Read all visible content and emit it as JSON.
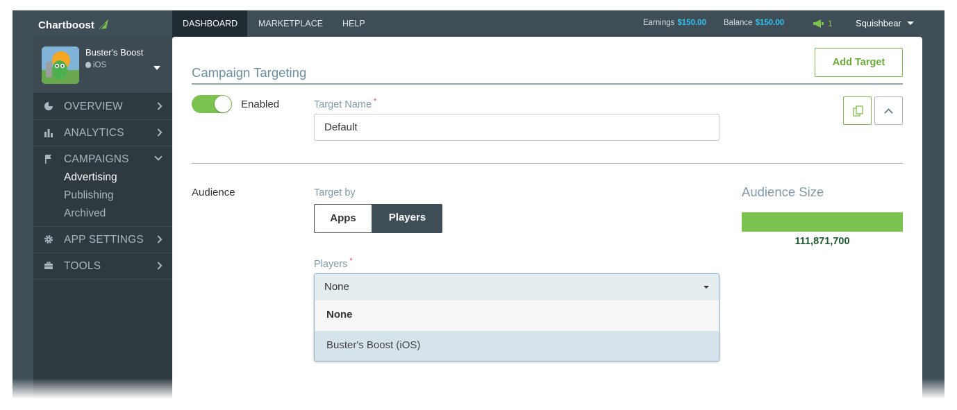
{
  "brand": {
    "name": "Chartboost"
  },
  "topnav": {
    "tabs": [
      "DASHBOARD",
      "MARKETPLACE",
      "HELP"
    ],
    "earnings_label": "Earnings",
    "earnings_value": "$150.00",
    "balance_label": "Balance",
    "balance_value": "$150.00",
    "notifications_count": "1",
    "user_name": "Squishbear"
  },
  "app": {
    "name": "Buster's Boost",
    "platform": "iOS"
  },
  "sidebar": {
    "items": [
      {
        "label": "OVERVIEW",
        "icon": "pie-chart-icon"
      },
      {
        "label": "ANALYTICS",
        "icon": "bar-chart-icon"
      },
      {
        "label": "CAMPAIGNS",
        "icon": "flag-icon"
      },
      {
        "label": "APP SETTINGS",
        "icon": "gear-icon"
      },
      {
        "label": "TOOLS",
        "icon": "toolbox-icon"
      }
    ],
    "campaigns_sub": [
      "Advertising",
      "Publishing",
      "Archived"
    ]
  },
  "page": {
    "title": "Campaign Targeting",
    "add_target_label": "Add Target",
    "enabled_label": "Enabled",
    "target_name_label": "Target Name",
    "required_mark": "*",
    "target_name_value": "Default",
    "audience_label": "Audience",
    "target_by_label": "Target by",
    "target_by_options": [
      "Apps",
      "Players"
    ],
    "target_by_selected": "Players",
    "players_label": "Players",
    "players_selected": "None",
    "players_options": [
      "None",
      "Buster's Boost (iOS)"
    ],
    "audience_size_title": "Audience Size",
    "audience_size_value": "111,871,700",
    "audience_fill_fraction": 1.0
  },
  "colors": {
    "accent_green": "#7cc24e",
    "stat_blue": "#35c2f0",
    "chrome_dark": "#3e4d56"
  }
}
